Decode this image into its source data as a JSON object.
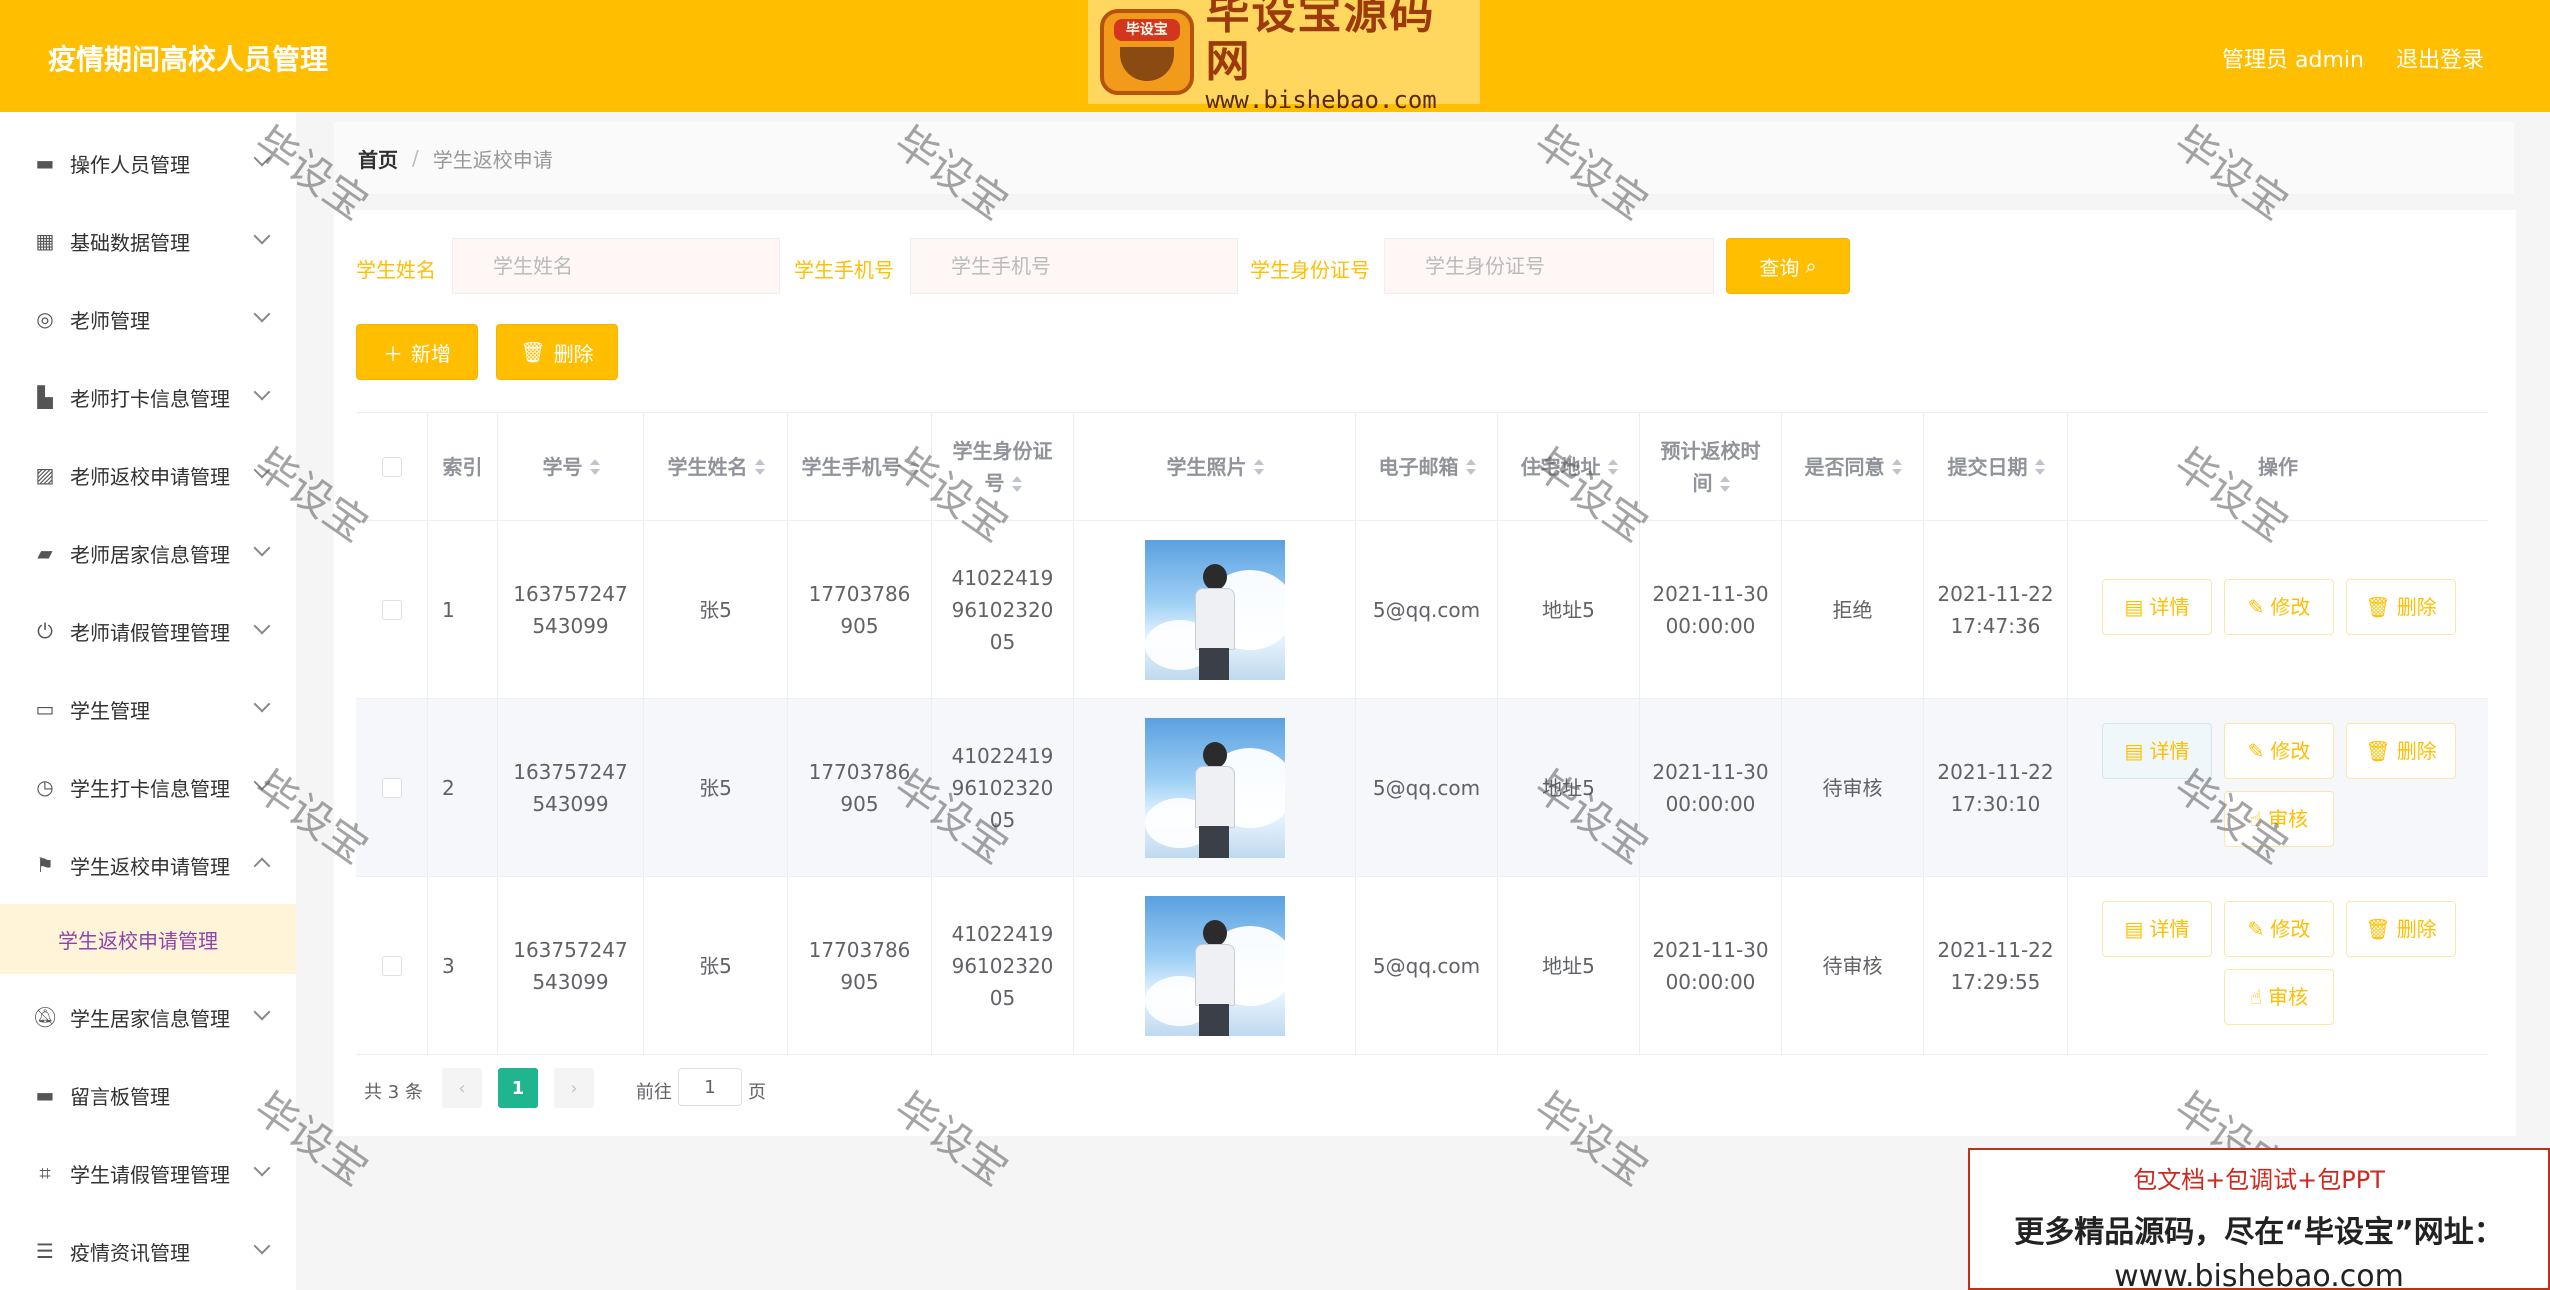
{
  "header": {
    "app_title": "疫情期间高校人员管理",
    "logo_cn": "毕设宝源码网",
    "logo_url": "www.bishebao.com",
    "logo_badge": "毕设宝",
    "admin_label": "管理员 admin",
    "logout_label": "退出登录"
  },
  "sidebar": {
    "items": [
      {
        "label": "操作人员管理",
        "icon": "wallet-icon"
      },
      {
        "label": "基础数据管理",
        "icon": "grid-icon"
      },
      {
        "label": "老师管理",
        "icon": "compass-icon"
      },
      {
        "label": "老师打卡信息管理",
        "icon": "brush-icon"
      },
      {
        "label": "老师返校申请管理",
        "icon": "chart-icon"
      },
      {
        "label": "老师居家信息管理",
        "icon": "ticket-icon"
      },
      {
        "label": "老师请假管理管理",
        "icon": "power-icon"
      },
      {
        "label": "学生管理",
        "icon": "message-icon"
      },
      {
        "label": "学生打卡信息管理",
        "icon": "stopwatch-icon"
      },
      {
        "label": "学生返校申请管理",
        "icon": "flag-icon"
      },
      {
        "label": "学生居家信息管理",
        "icon": "bell-off-icon"
      },
      {
        "label": "留言板管理",
        "icon": "printer-icon"
      },
      {
        "label": "学生请假管理管理",
        "icon": "crop-icon"
      },
      {
        "label": "疫情资讯管理",
        "icon": "menu-icon"
      }
    ],
    "active_sub": "学生返校申请管理"
  },
  "breadcrumb": {
    "home": "首页",
    "separator": "/",
    "current": "学生返校申请"
  },
  "search": {
    "name_label": "学生姓名",
    "name_placeholder": "学生姓名",
    "phone_label": "学生手机号",
    "phone_placeholder": "学生手机号",
    "idcard_label": "学生身份证号",
    "idcard_placeholder": "学生身份证号",
    "query_button": "查询"
  },
  "toolbar": {
    "add_button": "新增",
    "delete_button": "删除"
  },
  "table": {
    "headers": {
      "index": "索引",
      "student_no": "学号",
      "name": "学生姓名",
      "phone": "学生手机号",
      "idcard": "学生身份证号",
      "photo": "学生照片",
      "email": "电子邮箱",
      "address": "住宅地址",
      "return_time": "预计返校时间",
      "agree": "是否同意",
      "submit_date": "提交日期",
      "ops": "操作"
    },
    "rows": [
      {
        "index": "1",
        "student_no": "163757247543099",
        "name": "张5",
        "phone": "17703786905",
        "idcard": "410224199610232005",
        "email": "5@qq.com",
        "address": "地址5",
        "return_time": "2021-11-30 00:00:00",
        "agree": "拒绝",
        "submit_date": "2021-11-22 17:47:36"
      },
      {
        "index": "2",
        "student_no": "163757247543099",
        "name": "张5",
        "phone": "17703786905",
        "idcard": "410224199610232005",
        "email": "5@qq.com",
        "address": "地址5",
        "return_time": "2021-11-30 00:00:00",
        "agree": "待审核",
        "submit_date": "2021-11-22 17:30:10"
      },
      {
        "index": "3",
        "student_no": "163757247543099",
        "name": "张5",
        "phone": "17703786905",
        "idcard": "410224199610232005",
        "email": "5@qq.com",
        "address": "地址5",
        "return_time": "2021-11-30 00:00:00",
        "agree": "待审核",
        "submit_date": "2021-11-22 17:29:55"
      }
    ],
    "op_labels": {
      "detail": "详情",
      "edit": "修改",
      "delete": "删除",
      "audit": "审核"
    }
  },
  "pagination": {
    "total": "共 3 条",
    "current_page": "1",
    "goto_prefix": "前往",
    "goto_value": "1",
    "goto_suffix": "页"
  },
  "watermark": "毕设宝",
  "promo": {
    "line1": "包文档+包调试+包PPT",
    "line2": "更多精品源码，尽在“毕设宝”网址：",
    "url": "www.bishebao.com"
  },
  "colors": {
    "accent": "#ffbf00",
    "active_page": "#1fb58f"
  }
}
